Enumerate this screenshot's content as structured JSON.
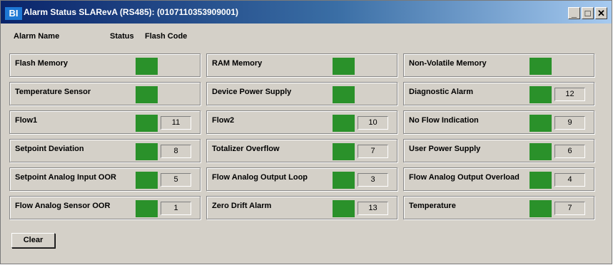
{
  "window": {
    "icon_text": "BI",
    "title": "Alarm Status SLARevA (RS485): (0107110353909001)",
    "buttons": {
      "minimize": "_",
      "maximize": "□",
      "close": "✕"
    }
  },
  "headers": {
    "alarm_name": "Alarm Name",
    "status": "Status",
    "flash_code": "Flash Code"
  },
  "status_color": "#2a912a",
  "alarms": [
    {
      "name": "Flash Memory",
      "code": ""
    },
    {
      "name": "RAM Memory",
      "code": ""
    },
    {
      "name": "Non-Volatile Memory",
      "code": ""
    },
    {
      "name": "Temperature Sensor",
      "code": ""
    },
    {
      "name": "Device Power Supply",
      "code": ""
    },
    {
      "name": "Diagnostic Alarm",
      "code": "12"
    },
    {
      "name": "Flow1",
      "code": "11"
    },
    {
      "name": "Flow2",
      "code": "10"
    },
    {
      "name": "No Flow Indication",
      "code": "9"
    },
    {
      "name": "Setpoint Deviation",
      "code": "8"
    },
    {
      "name": "Totalizer Overflow",
      "code": "7"
    },
    {
      "name": "User Power Supply",
      "code": "6"
    },
    {
      "name": "Setpoint Analog Input OOR",
      "code": "5"
    },
    {
      "name": "Flow Analog Output Loop",
      "code": "3"
    },
    {
      "name": "Flow Analog Output Overload",
      "code": "4"
    },
    {
      "name": "Flow Analog Sensor OOR",
      "code": "1"
    },
    {
      "name": "Zero Drift Alarm",
      "code": "13"
    },
    {
      "name": "Temperature",
      "code": "7"
    }
  ],
  "clear_label": "Clear"
}
